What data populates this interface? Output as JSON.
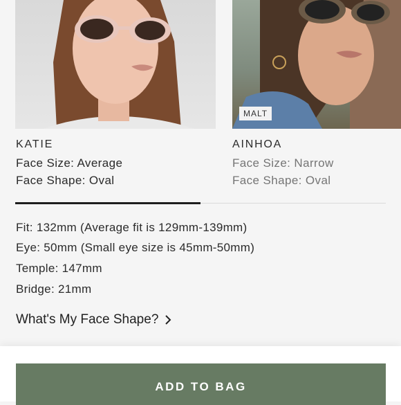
{
  "models": [
    {
      "name": "KATIE",
      "face_size": "Face Size: Average",
      "face_shape": "Face Shape: Oval",
      "active": true
    },
    {
      "name": "AINHOA",
      "face_size": "Face Size: Narrow",
      "face_shape": "Face Shape: Oval",
      "badge": "MALT",
      "active": false
    }
  ],
  "specs": {
    "fit": "Fit: 132mm (Average fit is 129mm-139mm)",
    "eye": "Eye: 50mm (Small eye size is 45mm-50mm)",
    "temple": "Temple: 147mm",
    "bridge": "Bridge: 21mm"
  },
  "face_shape_link": "What's My Face Shape?",
  "add_to_bag": "ADD TO BAG",
  "colors": {
    "button": "#677b63",
    "active_tab": "#1e1e1e",
    "inactive_text": "#757575"
  }
}
